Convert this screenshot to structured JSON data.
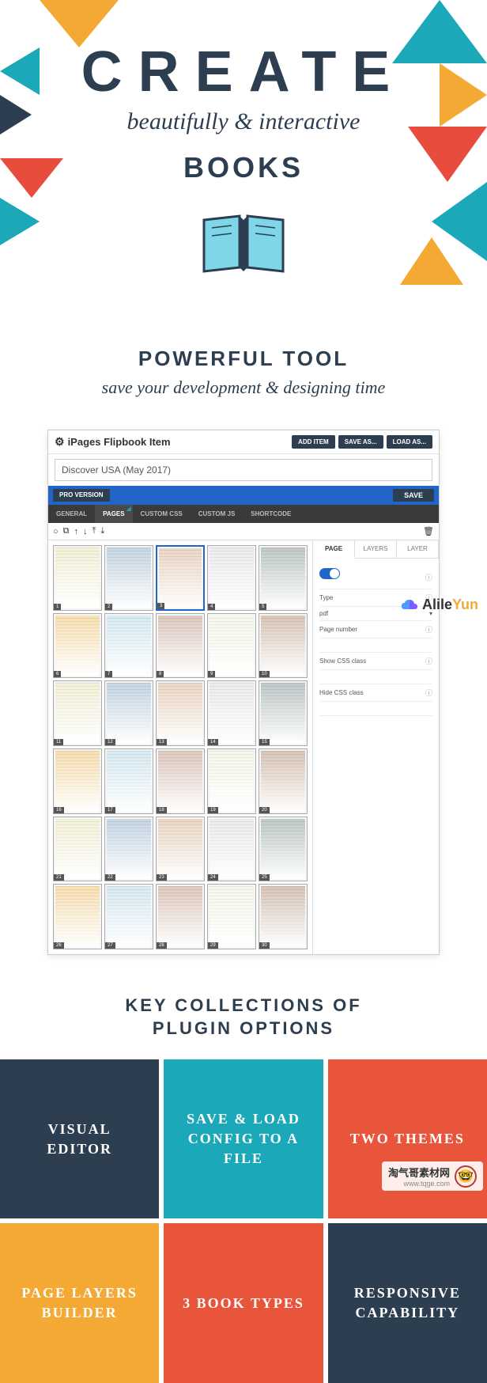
{
  "hero": {
    "title": "CREATE",
    "subtitle": "beautifully & interactive",
    "books": "BOOKS"
  },
  "powerful": {
    "title": "POWERFUL TOOL",
    "tagline": "save your development & designing time"
  },
  "app": {
    "title": "iPages Flipbook Item",
    "buttons": {
      "add": "ADD ITEM",
      "saveas": "SAVE AS...",
      "load": "LOAD AS..."
    },
    "item_name": "Discover USA (May 2017)",
    "pro": "PRO VERSION",
    "save": "SAVE",
    "tabs": [
      "GENERAL",
      "PAGES",
      "CUSTOM CSS",
      "CUSTOM JS",
      "SHORTCODE"
    ],
    "active_tab": 1,
    "thumb_count": 30,
    "selected_thumb": 3,
    "prop_tabs": [
      "PAGE",
      "LAYERS",
      "LAYER"
    ],
    "active_prop_tab": 0,
    "props": {
      "type_label": "Type",
      "type_value": "pdf",
      "page_number": "Page number",
      "show_css": "Show CSS class",
      "hide_css": "Hide CSS class"
    }
  },
  "watermark": {
    "brand_a": "Alile",
    "brand_b": "Yun"
  },
  "key": {
    "title_l1": "KEY COLLECTIONS OF",
    "title_l2": "PLUGIN OPTIONS"
  },
  "features": [
    "VISUAL EDITOR",
    "SAVE & LOAD CONFIG TO A FILE",
    "TWO THEMES",
    "PAGE LAYERS BUILDER",
    "3 BOOK TYPES",
    "RESPONSIVE CAPABILITY"
  ],
  "footer": {
    "line1": "淘气哥素材网",
    "line2": "www.tqge.com"
  }
}
